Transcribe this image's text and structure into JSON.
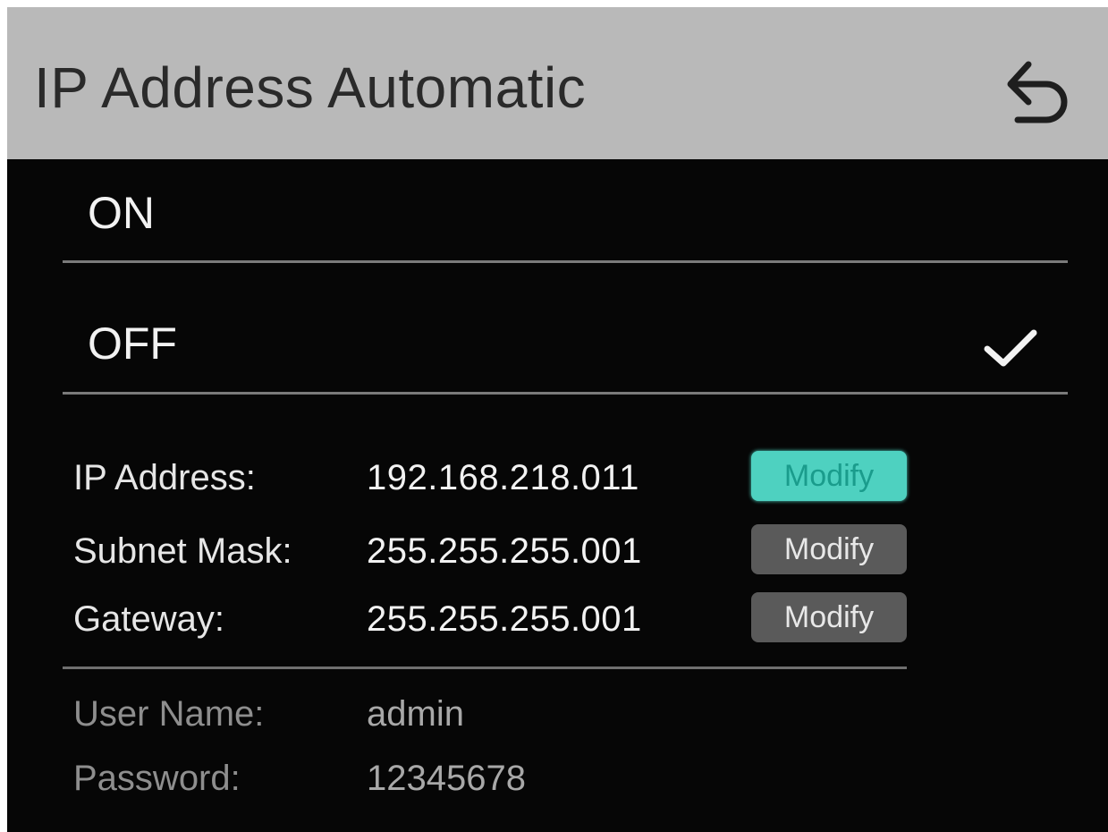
{
  "header": {
    "title": "IP Address Automatic",
    "back_icon": "undo-arrow-icon"
  },
  "options": [
    {
      "label": "ON",
      "selected": false
    },
    {
      "label": "OFF",
      "selected": true
    }
  ],
  "check_icon": "checkmark-icon",
  "network": {
    "ip_address": {
      "label": "IP Address:",
      "value": "192.168.218.011",
      "button_label": "Modify",
      "focused": true
    },
    "subnet_mask": {
      "label": "Subnet Mask:",
      "value": "255.255.255.001",
      "button_label": "Modify",
      "focused": false
    },
    "gateway": {
      "label": "Gateway:",
      "value": "255.255.255.001",
      "button_label": "Modify",
      "focused": false
    }
  },
  "credentials": {
    "user_name": {
      "label": "User Name:",
      "value": "admin"
    },
    "password": {
      "label": "Password:",
      "value": "12345678"
    }
  },
  "colors": {
    "header_bg": "#b9b9b9",
    "screen_bg": "#060606",
    "accent": "#4ed1c0",
    "button_bg": "#5a5a5a"
  }
}
